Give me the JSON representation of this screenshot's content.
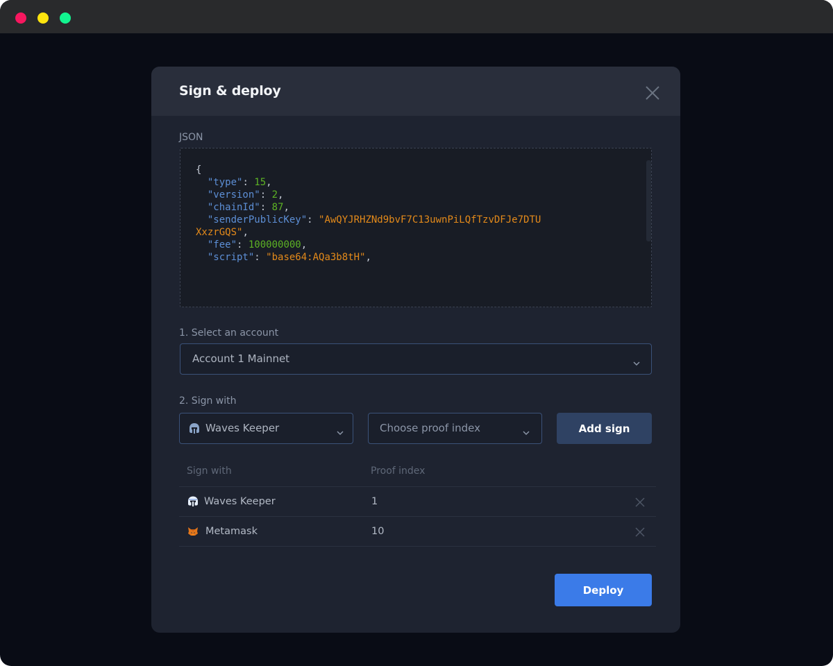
{
  "window": {
    "controls": [
      "close",
      "minimize",
      "maximize"
    ]
  },
  "modal": {
    "title": "Sign & deploy",
    "close_icon": "close-icon"
  },
  "json_section": {
    "label": "JSON",
    "open_brace": "{",
    "entries": [
      {
        "key": "\"type\"",
        "value": "15",
        "value_type": "number"
      },
      {
        "key": "\"version\"",
        "value": "2",
        "value_type": "number"
      },
      {
        "key": "\"chainId\"",
        "value": "87",
        "value_type": "number"
      },
      {
        "key": "\"senderPublicKey\"",
        "value": "\"AwQYJRHZNd9bvF7C13uwnPiLQfTzvDFJe7DTU",
        "value_cont": "XxzrGQS\"",
        "value_type": "string"
      },
      {
        "key": "\"fee\"",
        "value": "100000000",
        "value_type": "number"
      },
      {
        "key": "\"script\"",
        "value": "\"base64:AQa3b8tH\"",
        "value_type": "string"
      }
    ]
  },
  "account_section": {
    "label": "1. Select an account",
    "selected": "Account 1 Mainnet"
  },
  "sign_section": {
    "label": "2. Sign with",
    "signer_selected": "Waves Keeper",
    "signer_icon": "waves-keeper-icon",
    "proof_placeholder": "Choose proof index",
    "add_button": "Add sign"
  },
  "signatures_table": {
    "headers": [
      "Sign with",
      "Proof index"
    ],
    "rows": [
      {
        "signer": "Waves Keeper",
        "icon": "waves-keeper-icon",
        "proof_index": "1"
      },
      {
        "signer": "Metamask",
        "icon": "metamask-icon",
        "proof_index": "10"
      }
    ]
  },
  "footer": {
    "deploy_button": "Deploy"
  },
  "colors": {
    "accent": "#3b7be8",
    "json_key": "#5d8fd6",
    "json_number": "#5db324",
    "json_string": "#e48a1a"
  }
}
